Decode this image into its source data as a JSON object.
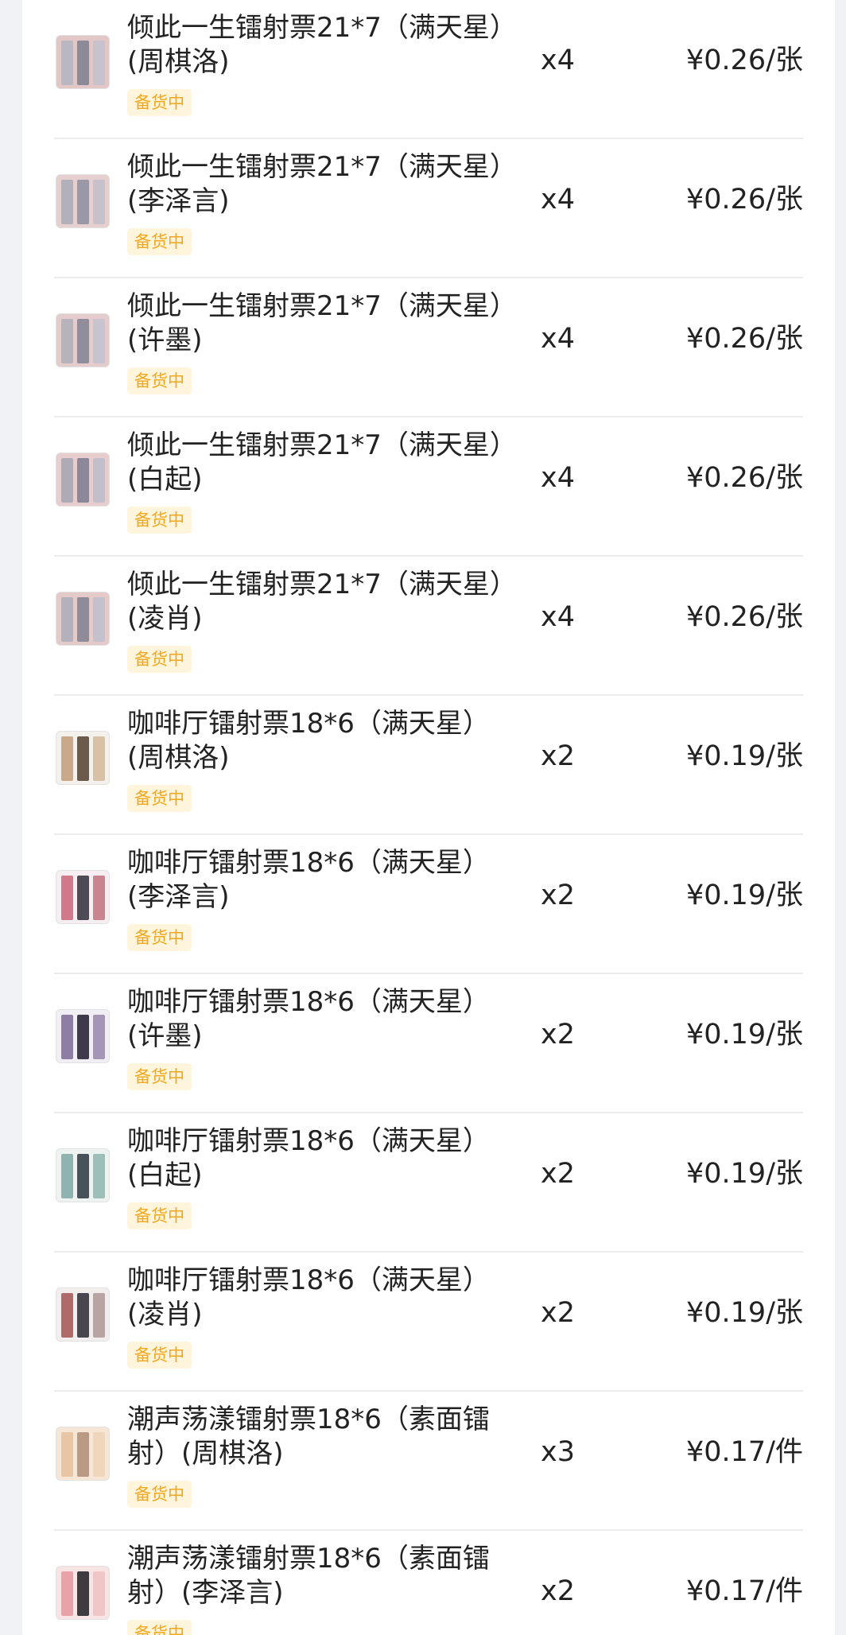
{
  "order_items": [
    {
      "title": "倾此一生镭射票21*7（满天星）(周棋洛)",
      "status": "备货中",
      "qty": "x4",
      "price": "¥0.26/张",
      "thumb_colors": [
        "#b9b7c2",
        "#8d8a98",
        "#c7c2cc"
      ],
      "thumb_bg": "#e3c7c7"
    },
    {
      "title": "倾此一生镭射票21*7（满天星）(李泽言)",
      "status": "备货中",
      "qty": "x4",
      "price": "¥0.26/张",
      "thumb_colors": [
        "#b2b0bb",
        "#9a97a6",
        "#c6c1cb"
      ],
      "thumb_bg": "#e6cfcf"
    },
    {
      "title": "倾此一生镭射票21*7（满天星）(许墨)",
      "status": "备货中",
      "qty": "x4",
      "price": "¥0.26/张",
      "thumb_colors": [
        "#b6b3bd",
        "#918e9c",
        "#c8c4cf"
      ],
      "thumb_bg": "#e4cccc"
    },
    {
      "title": "倾此一生镭射票21*7（满天星）(白起)",
      "status": "备货中",
      "qty": "x4",
      "price": "¥0.26/张",
      "thumb_colors": [
        "#aeaab6",
        "#8c889a",
        "#c3bfca"
      ],
      "thumb_bg": "#e7cdcd"
    },
    {
      "title": "倾此一生镭射票21*7（满天星）(凌肖)",
      "status": "备货中",
      "qty": "x4",
      "price": "¥0.26/张",
      "thumb_colors": [
        "#b4b0bc",
        "#8f8b99",
        "#c5c1cc"
      ],
      "thumb_bg": "#e5caca"
    },
    {
      "title": "咖啡厅镭射票18*6（满天星）(周棋洛)",
      "status": "备货中",
      "qty": "x2",
      "price": "¥0.19/张",
      "thumb_colors": [
        "#c9a98a",
        "#6c5a4d",
        "#d8c1a5"
      ],
      "thumb_bg": "#f4f1ec"
    },
    {
      "title": "咖啡厅镭射票18*6（满天星）(李泽言)",
      "status": "备货中",
      "qty": "x2",
      "price": "¥0.19/张",
      "thumb_colors": [
        "#d0798a",
        "#4e4a56",
        "#c9848f"
      ],
      "thumb_bg": "#f6eef0"
    },
    {
      "title": "咖啡厅镭射票18*6（满天星）(许墨)",
      "status": "备货中",
      "qty": "x2",
      "price": "¥0.19/张",
      "thumb_colors": [
        "#8e7ea6",
        "#3f3a4b",
        "#a596b8"
      ],
      "thumb_bg": "#f1eef5"
    },
    {
      "title": "咖啡厅镭射票18*6（满天星）(白起)",
      "status": "备货中",
      "qty": "x2",
      "price": "¥0.19/张",
      "thumb_colors": [
        "#8fb3ae",
        "#48525a",
        "#9cbfba"
      ],
      "thumb_bg": "#eef3f2"
    },
    {
      "title": "咖啡厅镭射票18*6（满天星）(凌肖)",
      "status": "备货中",
      "qty": "x2",
      "price": "¥0.19/张",
      "thumb_colors": [
        "#b06a6a",
        "#4a4650",
        "#b9a3a3"
      ],
      "thumb_bg": "#f2eeee"
    },
    {
      "title": "潮声荡漾镭射票18*6（素面镭射）(周棋洛)",
      "status": "备货中",
      "qty": "x3",
      "price": "¥0.17/件",
      "thumb_colors": [
        "#e8c6a3",
        "#b89a85",
        "#f0d6bb"
      ],
      "thumb_bg": "#f5e6d5"
    },
    {
      "title": "潮声荡漾镭射票18*6（素面镭射）(李泽言)",
      "status": "备货中",
      "qty": "x2",
      "price": "¥0.17/件",
      "thumb_colors": [
        "#e7a3a8",
        "#3d3a40",
        "#f1c6c9"
      ],
      "thumb_bg": "#f8e3e5"
    }
  ]
}
